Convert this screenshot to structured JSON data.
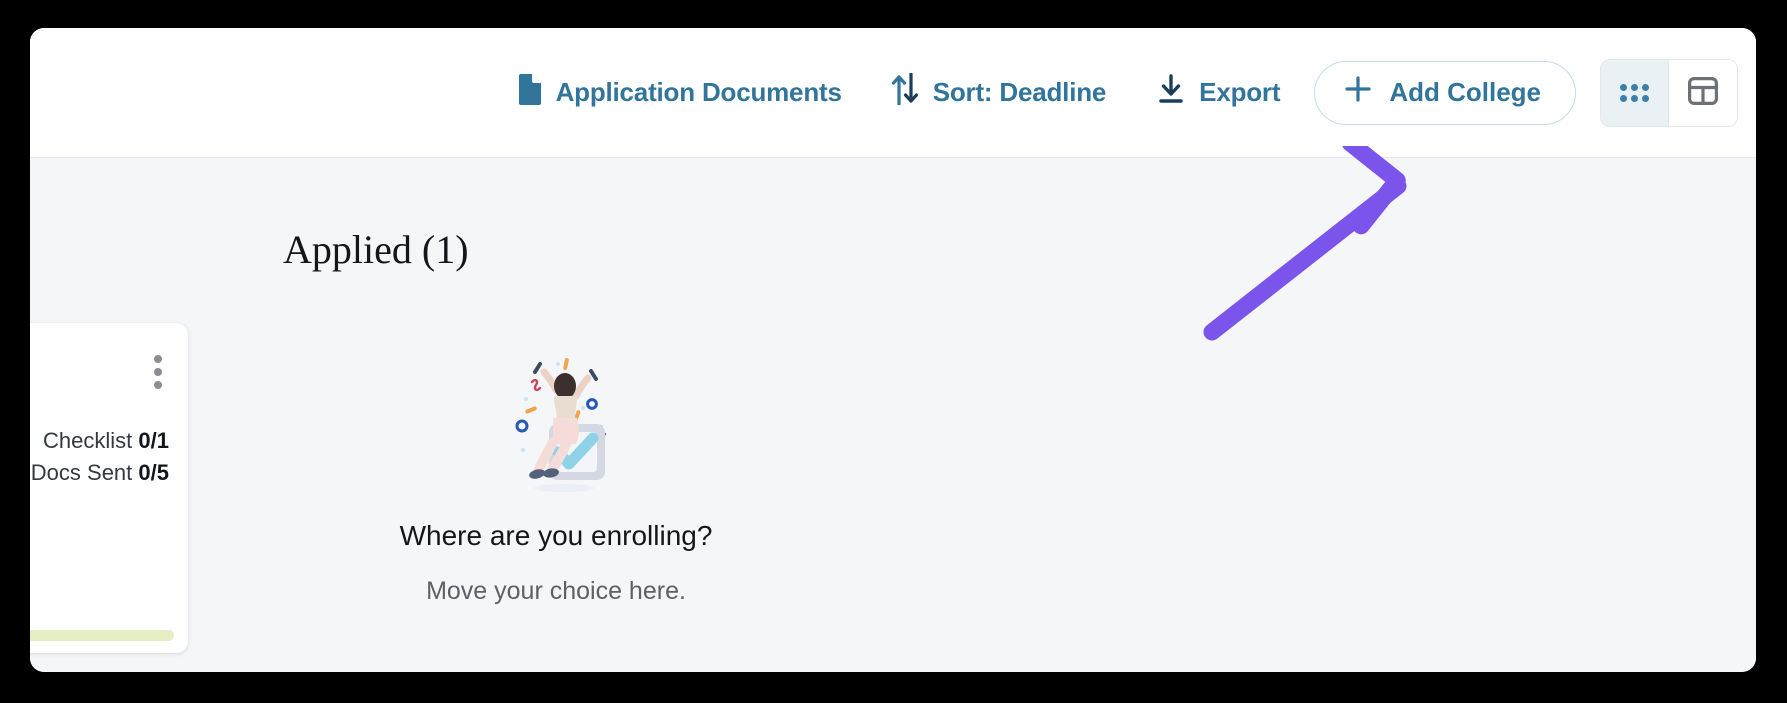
{
  "toolbar": {
    "actions": [
      {
        "id": "application-documents",
        "label": "Application Documents",
        "icon": "document-icon"
      },
      {
        "id": "sort",
        "label": "Sort: Deadline",
        "icon": "sort-arrows-icon"
      },
      {
        "id": "export",
        "label": "Export",
        "icon": "download-icon"
      }
    ],
    "add_college_label": "Add College",
    "add_college_icon": "plus-icon",
    "view_toggle": {
      "grid_icon": "grid-dots-icon",
      "grid_active": true,
      "table_icon": "table-icon",
      "table_active": false
    }
  },
  "board": {
    "column_heading": "Applied (1)"
  },
  "card": {
    "menu_icon": "kebab-menu-icon",
    "checklist_label": "Checklist",
    "checklist_value": "0/1",
    "docs_sent_label": "Docs Sent",
    "docs_sent_value": "0/5",
    "progress_percent": 100
  },
  "dropzone": {
    "illustration": "celebration-checkbox-illustration",
    "title": "Where are you enrolling?",
    "subtitle": "Move your choice here."
  },
  "annotation": {
    "arrow_icon": "pointer-arrow-icon",
    "color": "#7b54ec"
  },
  "colors": {
    "accent_blue": "#31749c",
    "window_background": "#ffffff",
    "content_background": "#f5f6f8",
    "progress_green": "#e6eec5",
    "annotation_purple": "#7b54ec"
  }
}
